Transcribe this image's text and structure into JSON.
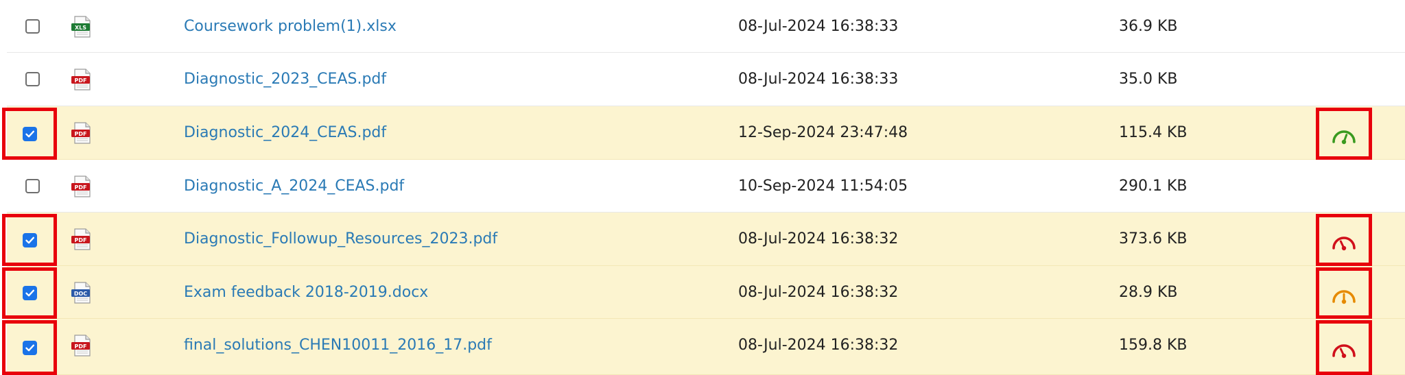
{
  "files": [
    {
      "name": "Coursework problem(1).xlsx",
      "date": "08-Jul-2024 16:38:33",
      "size": "36.9 KB",
      "type_icon": "xls-file-icon",
      "type_label": "XLS",
      "checked": false,
      "highlighted": false,
      "gauge": null
    },
    {
      "name": "Diagnostic_2023_CEAS.pdf",
      "date": "08-Jul-2024 16:38:33",
      "size": "35.0 KB",
      "type_icon": "pdf-file-icon",
      "type_label": "PDF",
      "checked": false,
      "highlighted": false,
      "gauge": null
    },
    {
      "name": "Diagnostic_2024_CEAS.pdf",
      "date": "12-Sep-2024 23:47:48",
      "size": "115.4 KB",
      "type_icon": "pdf-file-icon",
      "type_label": "PDF",
      "checked": true,
      "highlighted": true,
      "gauge": {
        "icon": "gauge-icon",
        "level": "low",
        "color": "#3a9a1f"
      }
    },
    {
      "name": "Diagnostic_A_2024_CEAS.pdf",
      "date": "10-Sep-2024 11:54:05",
      "size": "290.1 KB",
      "type_icon": "pdf-file-icon",
      "type_label": "PDF",
      "checked": false,
      "highlighted": false,
      "gauge": null
    },
    {
      "name": "Diagnostic_Followup_Resources_2023.pdf",
      "date": "08-Jul-2024 16:38:32",
      "size": "373.6 KB",
      "type_icon": "pdf-file-icon",
      "type_label": "PDF",
      "checked": true,
      "highlighted": true,
      "gauge": {
        "icon": "gauge-icon",
        "level": "high",
        "color": "#d0101b"
      }
    },
    {
      "name": "Exam feedback 2018-2019.docx",
      "date": "08-Jul-2024 16:38:32",
      "size": "28.9 KB",
      "type_icon": "doc-file-icon",
      "type_label": "DOC",
      "checked": true,
      "highlighted": true,
      "gauge": {
        "icon": "gauge-icon",
        "level": "medium",
        "color": "#e68a00"
      }
    },
    {
      "name": "final_solutions_CHEN10011_2016_17.pdf",
      "date": "08-Jul-2024 16:38:32",
      "size": "159.8 KB",
      "type_icon": "pdf-file-icon",
      "type_label": "PDF",
      "checked": true,
      "highlighted": true,
      "gauge": {
        "icon": "gauge-icon",
        "level": "high",
        "color": "#d0101b"
      }
    }
  ],
  "colors": {
    "selected_row_bg": "#fcf4d0",
    "highlight_border": "#e8000b",
    "link": "#2a7ab5",
    "checkbox_checked": "#1a73e8",
    "xls_icon": "#1e7b34",
    "pdf_icon": "#c8161d",
    "doc_icon": "#2b5aa8"
  }
}
